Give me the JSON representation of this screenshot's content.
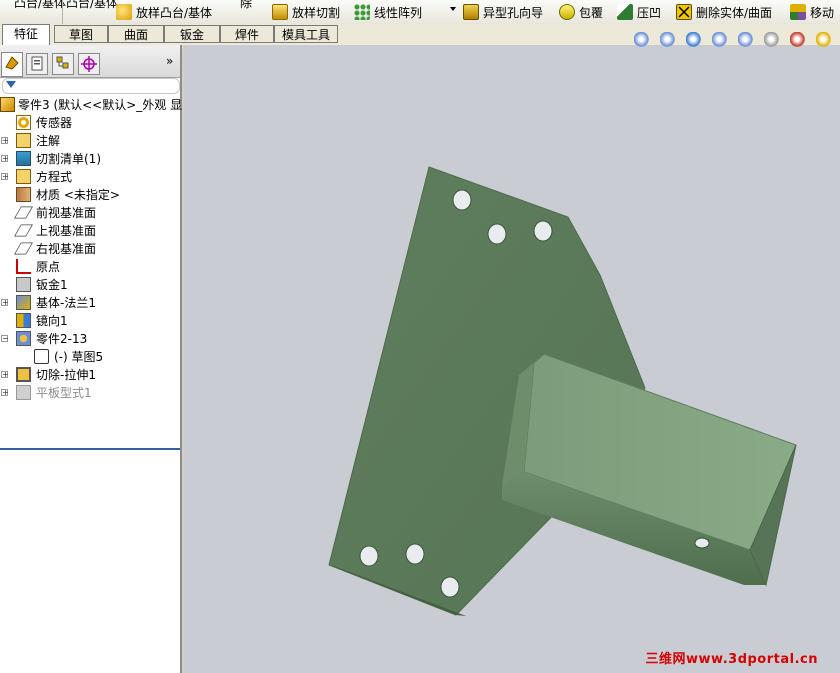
{
  "toolbar": {
    "cut_left_1": "凸台/基体",
    "cut_left_2": "凸台/基体",
    "cut_mid": "除",
    "items": [
      {
        "label": "放样凸台/基体",
        "icon": "loft-boss-icon",
        "color": "#e0b000"
      },
      {
        "label": "放样切割",
        "icon": "loft-cut-icon",
        "color": "#d8a000"
      },
      {
        "label": "线性阵列",
        "icon": "linear-pattern-icon",
        "color": "#2f8a2f"
      },
      {
        "label": "异型孔向导",
        "icon": "hole-wizard-icon",
        "color": "#c89a00"
      },
      {
        "label": "包覆",
        "icon": "wrap-icon",
        "color": "#d8c000"
      },
      {
        "label": "压凹",
        "icon": "indent-icon",
        "color": "#2e7d32"
      },
      {
        "label": "删除实体/曲面",
        "icon": "delete-body-icon",
        "color": "#e0b000"
      },
      {
        "label": "移动",
        "icon": "move-copy-body-icon",
        "color": "#7a4fa0"
      }
    ]
  },
  "tabs": [
    {
      "label": "特征",
      "active": true
    },
    {
      "label": "草图"
    },
    {
      "label": "曲面"
    },
    {
      "label": "钣金"
    },
    {
      "label": "焊件"
    },
    {
      "label": "模具工具"
    }
  ],
  "panel": {
    "tabs": [
      "feature-manager-tab",
      "property-manager-tab",
      "configuration-manager-tab",
      "dimxpert-tab"
    ],
    "more": "»",
    "root": "零件3  (默认<<默认>_外观 显",
    "tree": [
      {
        "label": "传感器",
        "icon": "sensor-icon",
        "expand": false,
        "indent": 0
      },
      {
        "label": "注解",
        "icon": "annotations-icon",
        "expand": true,
        "indent": 0
      },
      {
        "label": "切割清单(1)",
        "icon": "cut-list-icon",
        "expand": true,
        "indent": 0
      },
      {
        "label": "方程式",
        "icon": "equations-icon",
        "expand": true,
        "indent": 0
      },
      {
        "label": "材质 <未指定>",
        "icon": "material-icon",
        "expand": false,
        "indent": 0
      },
      {
        "label": "前视基准面",
        "icon": "plane-icon",
        "expand": false,
        "indent": 0
      },
      {
        "label": "上视基准面",
        "icon": "plane-icon",
        "expand": false,
        "indent": 0
      },
      {
        "label": "右视基准面",
        "icon": "plane-icon",
        "expand": false,
        "indent": 0
      },
      {
        "label": "原点",
        "icon": "origin-icon",
        "expand": false,
        "indent": 0
      },
      {
        "label": "钣金1",
        "icon": "sheet-metal-icon",
        "expand": false,
        "indent": 0
      },
      {
        "label": "基体-法兰1",
        "icon": "base-flange-icon",
        "expand": true,
        "indent": 0
      },
      {
        "label": "镜向1",
        "icon": "mirror-icon",
        "expand": false,
        "indent": 0
      },
      {
        "label": "零件2-13",
        "icon": "derived-part-icon",
        "expand": "open",
        "indent": 0
      },
      {
        "label": "(-) 草图5",
        "icon": "sketch-icon",
        "expand": false,
        "indent": 1
      },
      {
        "label": "切除-拉伸1",
        "icon": "cut-extrude-icon",
        "expand": true,
        "indent": 0
      },
      {
        "label": "平板型式1",
        "icon": "flat-pattern-icon",
        "expand": true,
        "indent": 0,
        "grey": true
      }
    ]
  },
  "viewport": {
    "background": "#c9ccd2",
    "part_color": "#5b7a5a",
    "part_light": "#7f9e7d",
    "heads_up": [
      "zoom-to-fit-icon",
      "zoom-to-area-icon",
      "previous-view-icon",
      "section-view-icon",
      "view-orientation-icon",
      "display-style-icon",
      "hide-show-items-icon",
      "edit-appearance-icon"
    ],
    "watermark": "三维网www.3dportal.cn"
  }
}
